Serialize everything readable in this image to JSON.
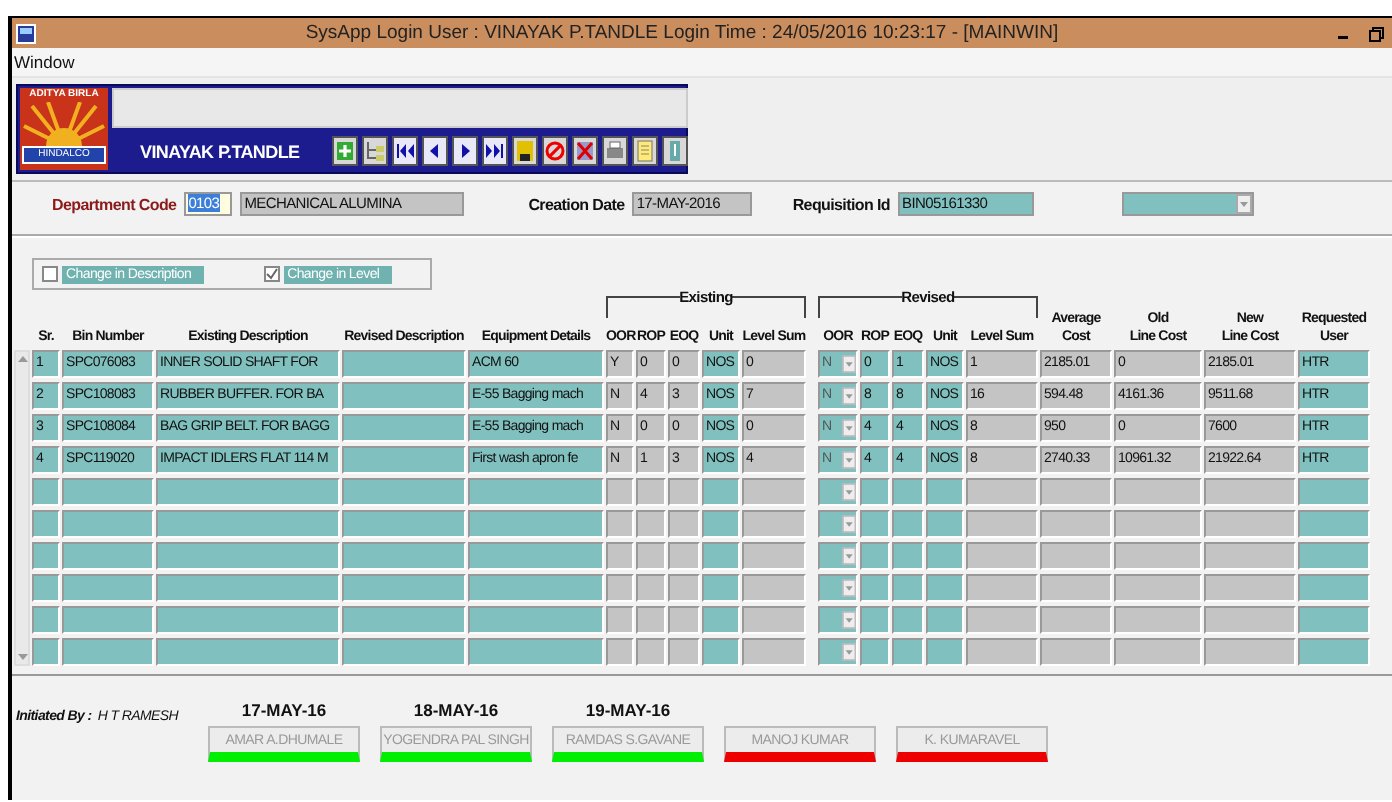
{
  "window": {
    "title": "SysApp  Login User : VINAYAK P.TANDLE  Login Time : 24/05/2016 10:23:17 - [MAINWIN]"
  },
  "menu": [
    "Window"
  ],
  "toolbar": {
    "logo_top": "ADITYA BIRLA",
    "logo_bottom": "HINDALCO",
    "user": "VINAYAK P.TANDLE"
  },
  "form": {
    "department_code": {
      "label": "Department Code",
      "code": "0103",
      "name": "MECHANICAL ALUMINA"
    },
    "creation_date": {
      "label": "Creation Date",
      "value": "17-MAY-2016"
    },
    "requisition_id": {
      "label": "Requisition Id",
      "value": "BIN05161330"
    }
  },
  "options": [
    {
      "label": "Change in Description",
      "checked": false
    },
    {
      "label": "Change in Level",
      "checked": true
    }
  ],
  "groups": [
    "Existing",
    "Revised"
  ],
  "columns": [
    "Sr.",
    "Bin Number",
    "Existing Description",
    "Revised Description",
    "Equipment Details",
    "OOR",
    "ROP",
    "EOQ",
    "Unit",
    "Level Sum",
    "OOR",
    "ROP",
    "EOQ",
    "Unit",
    "Level Sum",
    "Average\nCost",
    "Old\nLine Cost",
    "New\nLine Cost",
    "Requested\nUser"
  ],
  "rows": [
    {
      "sr": "1",
      "bin_number": "SPC076083",
      "existing_description": "INNER SOLID SHAFT FOR",
      "equipment_details": "ACM 60",
      "existing": {
        "oor": "Y",
        "rop": "0",
        "eoq": "0",
        "unit": "NOS",
        "level_sum": "0"
      },
      "revised": {
        "oor": "N",
        "rop": "0",
        "eoq": "1",
        "unit": "NOS",
        "level_sum": "1"
      },
      "average_cost": "2185.01",
      "old_line_cost": "0",
      "new_line_cost": "2185.01",
      "requested_user": "HTR"
    },
    {
      "sr": "2",
      "bin_number": "SPC108083",
      "existing_description": "RUBBER BUFFER. FOR BA",
      "equipment_details": "E-55 Bagging mach",
      "existing": {
        "oor": "N",
        "rop": "4",
        "eoq": "3",
        "unit": "NOS",
        "level_sum": "7"
      },
      "revised": {
        "oor": "N",
        "rop": "8",
        "eoq": "8",
        "unit": "NOS",
        "level_sum": "16"
      },
      "average_cost": "594.48",
      "old_line_cost": "4161.36",
      "new_line_cost": "9511.68",
      "requested_user": "HTR"
    },
    {
      "sr": "3",
      "bin_number": "SPC108084",
      "existing_description": "BAG GRIP BELT. FOR BAGG",
      "equipment_details": "E-55 Bagging mach",
      "existing": {
        "oor": "N",
        "rop": "0",
        "eoq": "0",
        "unit": "NOS",
        "level_sum": "0"
      },
      "revised": {
        "oor": "N",
        "rop": "4",
        "eoq": "4",
        "unit": "NOS",
        "level_sum": "8"
      },
      "average_cost": "950",
      "old_line_cost": "0",
      "new_line_cost": "7600",
      "requested_user": "HTR"
    },
    {
      "sr": "4",
      "bin_number": "SPC119020",
      "existing_description": "IMPACT IDLERS FLAT 114 M",
      "equipment_details": "First wash apron fe",
      "existing": {
        "oor": "N",
        "rop": "1",
        "eoq": "3",
        "unit": "NOS",
        "level_sum": "4"
      },
      "revised": {
        "oor": "N",
        "rop": "4",
        "eoq": "4",
        "unit": "NOS",
        "level_sum": "8"
      },
      "average_cost": "2740.33",
      "old_line_cost": "10961.32",
      "new_line_cost": "21922.64",
      "requested_user": "HTR"
    }
  ],
  "initiated_by": {
    "label": "Initiated By :",
    "name": "H T RAMESH"
  },
  "approvers": [
    {
      "date": "17-MAY-16",
      "name": "AMAR A.DHUMALE",
      "color": "#00ee00"
    },
    {
      "date": "18-MAY-16",
      "name": "YOGENDRA PAL SINGH",
      "color": "#00ee00"
    },
    {
      "date": "19-MAY-16",
      "name": "RAMDAS S.GAVANE",
      "color": "#00ee00"
    },
    {
      "name": "MANOJ KUMAR",
      "color": "#ee0000"
    },
    {
      "name": "K. KUMARAVEL",
      "color": "#ee0000"
    }
  ]
}
